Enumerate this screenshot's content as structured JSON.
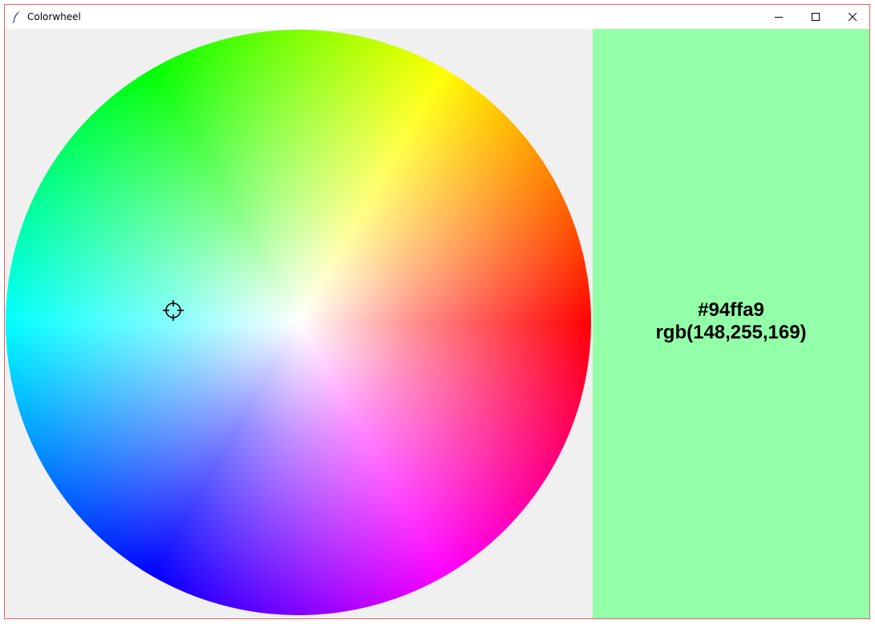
{
  "window": {
    "title": "Colorwheel",
    "controls": {
      "minimize_icon": "minimize-icon",
      "maximize_icon": "maximize-icon",
      "close_icon": "close-icon"
    }
  },
  "color": {
    "hex": "#94ffa9",
    "rgb": "rgb(148,255,169)",
    "swatch": "#94ffa9"
  }
}
